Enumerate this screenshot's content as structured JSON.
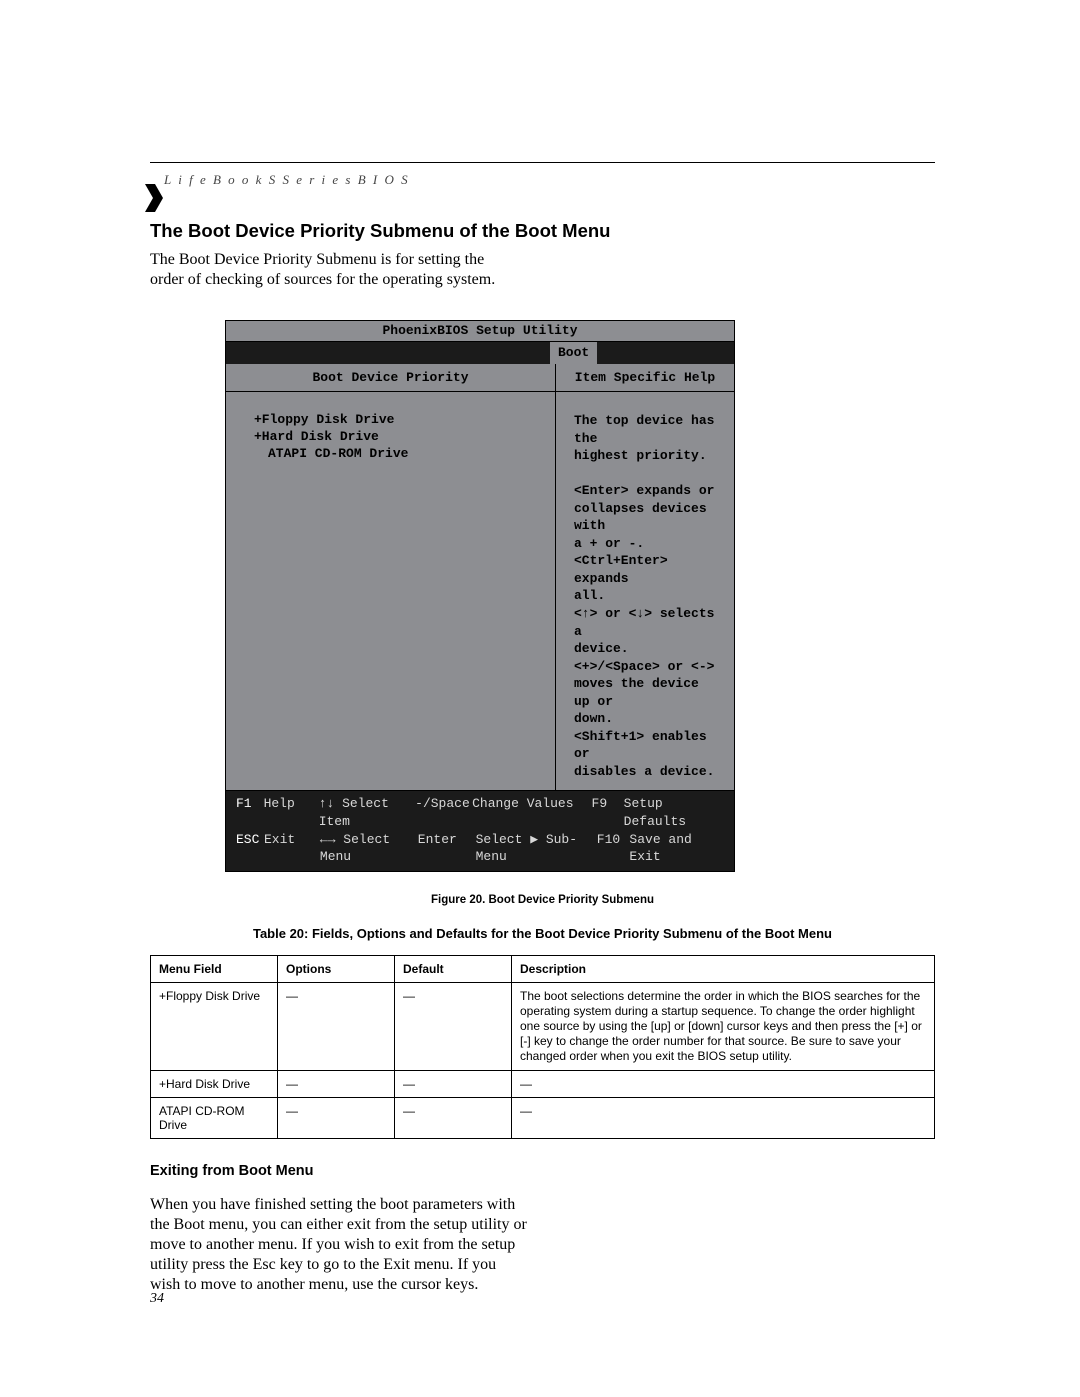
{
  "header": "L i f e B o o k   S   S e r i e s   B I O S",
  "section_title": "The Boot Device Priority Submenu of the Boot Menu",
  "intro": "The Boot Device Priority Submenu is for setting the order of checking of sources for the operating system.",
  "bios": {
    "title": "PhoenixBIOS Setup Utility",
    "active_menu": "Boot",
    "left_header": "Boot Device Priority",
    "right_header": "Item Specific Help",
    "devices": [
      "+Floppy Disk Drive",
      "+Hard Disk Drive",
      "ATAPI CD-ROM Drive"
    ],
    "help_lines": [
      "The top device has the",
      "highest priority.",
      "",
      "<Enter> expands or",
      "collapses devices with",
      "a + or -.",
      "<Ctrl+Enter> expands",
      "all.",
      "<↑> or <↓> selects a",
      "device.",
      "<+>/<Space> or <->",
      "moves the device up or",
      "down.",
      "<Shift+1> enables or",
      "disables a device."
    ],
    "footer": {
      "row1": {
        "k1": "F1",
        "l1": "Help",
        "a": "↑↓ Select Item",
        "k2": "-/Space",
        "l2": "Change Values",
        "k3": "F9",
        "l3": "Setup Defaults"
      },
      "row2": {
        "k1": "ESC",
        "l1": "Exit",
        "a": "←→ Select Menu",
        "k2": "Enter",
        "l2": "Select ▶ Sub-Menu",
        "k3": "F10",
        "l3": "Save and Exit"
      }
    }
  },
  "figure_caption": "Figure 20. Boot Device Priority Submenu",
  "table_caption": "Table 20: Fields, Options and Defaults for the Boot Device Priority Submenu of the Boot Menu",
  "table": {
    "headers": [
      "Menu Field",
      "Options",
      "Default",
      "Description"
    ],
    "rows": [
      {
        "menu": "+Floppy Disk Drive",
        "options": "—",
        "default": "—",
        "description": "The boot selections determine the order in which the BIOS searches for the operating system during a startup sequence. To change the order highlight one source by using the [up] or [down] cursor keys and then press the [+] or [-] key to change the order number for that source. Be sure to save your changed order when you exit the BIOS setup utility."
      },
      {
        "menu": "+Hard Disk Drive",
        "options": "—",
        "default": "—",
        "description": "—"
      },
      {
        "menu": "ATAPI CD-ROM Drive",
        "options": "—",
        "default": "—",
        "description": "—"
      }
    ]
  },
  "subhead": "Exiting from Boot Menu",
  "body2": "When you have finished setting the boot parameters with the Boot menu, you can either exit from the setup utility or move to another menu. If you wish to exit from the setup utility press the Esc key to go to the Exit menu. If you wish to move to another menu, use the cursor keys.",
  "page_number": "34"
}
